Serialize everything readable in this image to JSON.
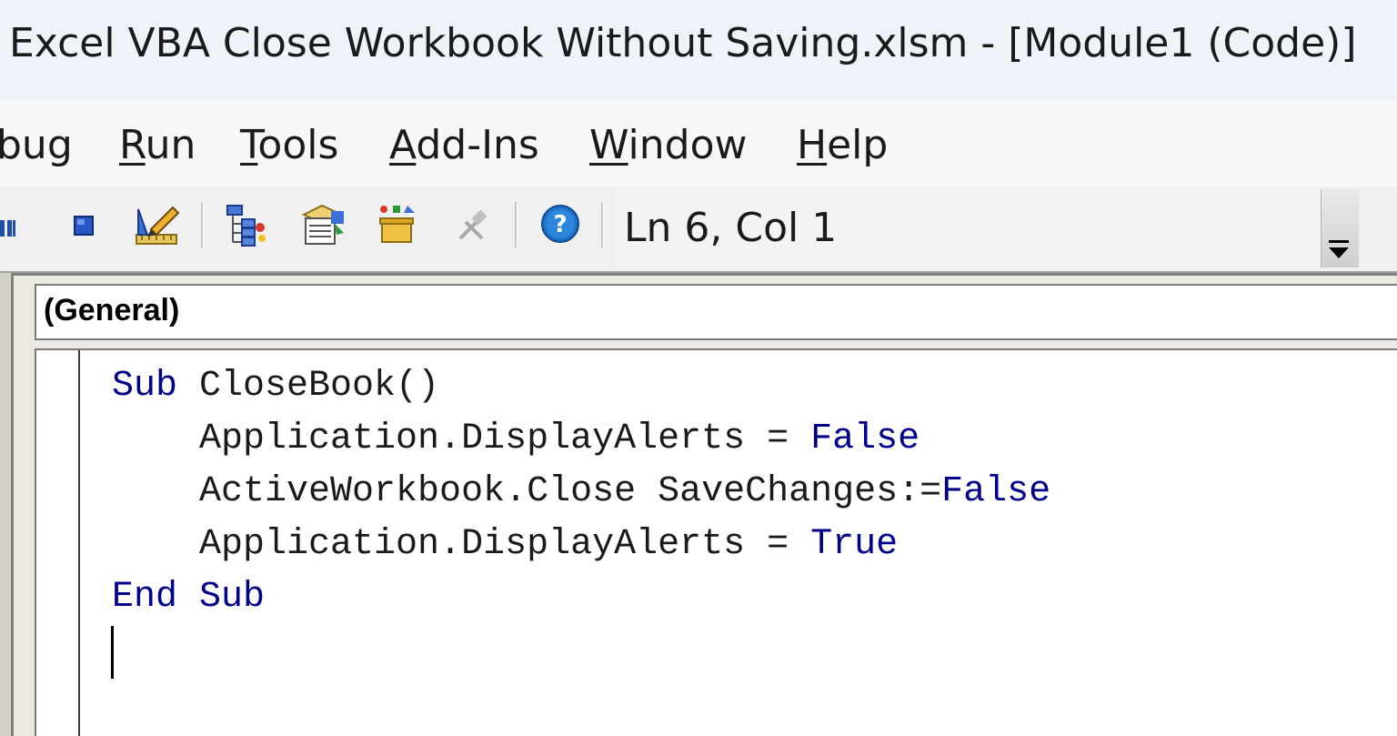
{
  "window": {
    "title": "Excel VBA Close Workbook Without Saving.xlsm - [Module1 (Code)]"
  },
  "menu": {
    "items": [
      {
        "prefix": "",
        "accel": "",
        "rest": "bug"
      },
      {
        "prefix": "",
        "accel": "R",
        "rest": "un"
      },
      {
        "prefix": "",
        "accel": "T",
        "rest": "ools"
      },
      {
        "prefix": "",
        "accel": "A",
        "rest": "dd-Ins"
      },
      {
        "prefix": "",
        "accel": "W",
        "rest": "indow"
      },
      {
        "prefix": "",
        "accel": "H",
        "rest": "elp"
      }
    ]
  },
  "toolbar": {
    "icons": [
      "break-icon",
      "reset-icon",
      "design-mode-icon",
      "project-explorer-icon",
      "properties-window-icon",
      "object-browser-icon",
      "toolbox-icon",
      "help-icon"
    ],
    "status": "Ln 6, Col 1"
  },
  "code_window": {
    "object_combo": "(General)",
    "lines": [
      {
        "indent": "",
        "kw1": "Sub",
        "text": " CloseBook()",
        "kw2": ""
      },
      {
        "indent": "    ",
        "kw1": "",
        "text": "Application.DisplayAlerts = ",
        "kw2": "False"
      },
      {
        "indent": "    ",
        "kw1": "",
        "text": "ActiveWorkbook.Close SaveChanges:=",
        "kw2": "False"
      },
      {
        "indent": "    ",
        "kw1": "",
        "text": "Application.DisplayAlerts = ",
        "kw2": "True"
      },
      {
        "indent": "",
        "kw1": "End Sub",
        "text": "",
        "kw2": ""
      }
    ]
  },
  "colors": {
    "keyword": "#00008b",
    "text": "#1a1a1a",
    "help_blue": "#1e73c8"
  }
}
